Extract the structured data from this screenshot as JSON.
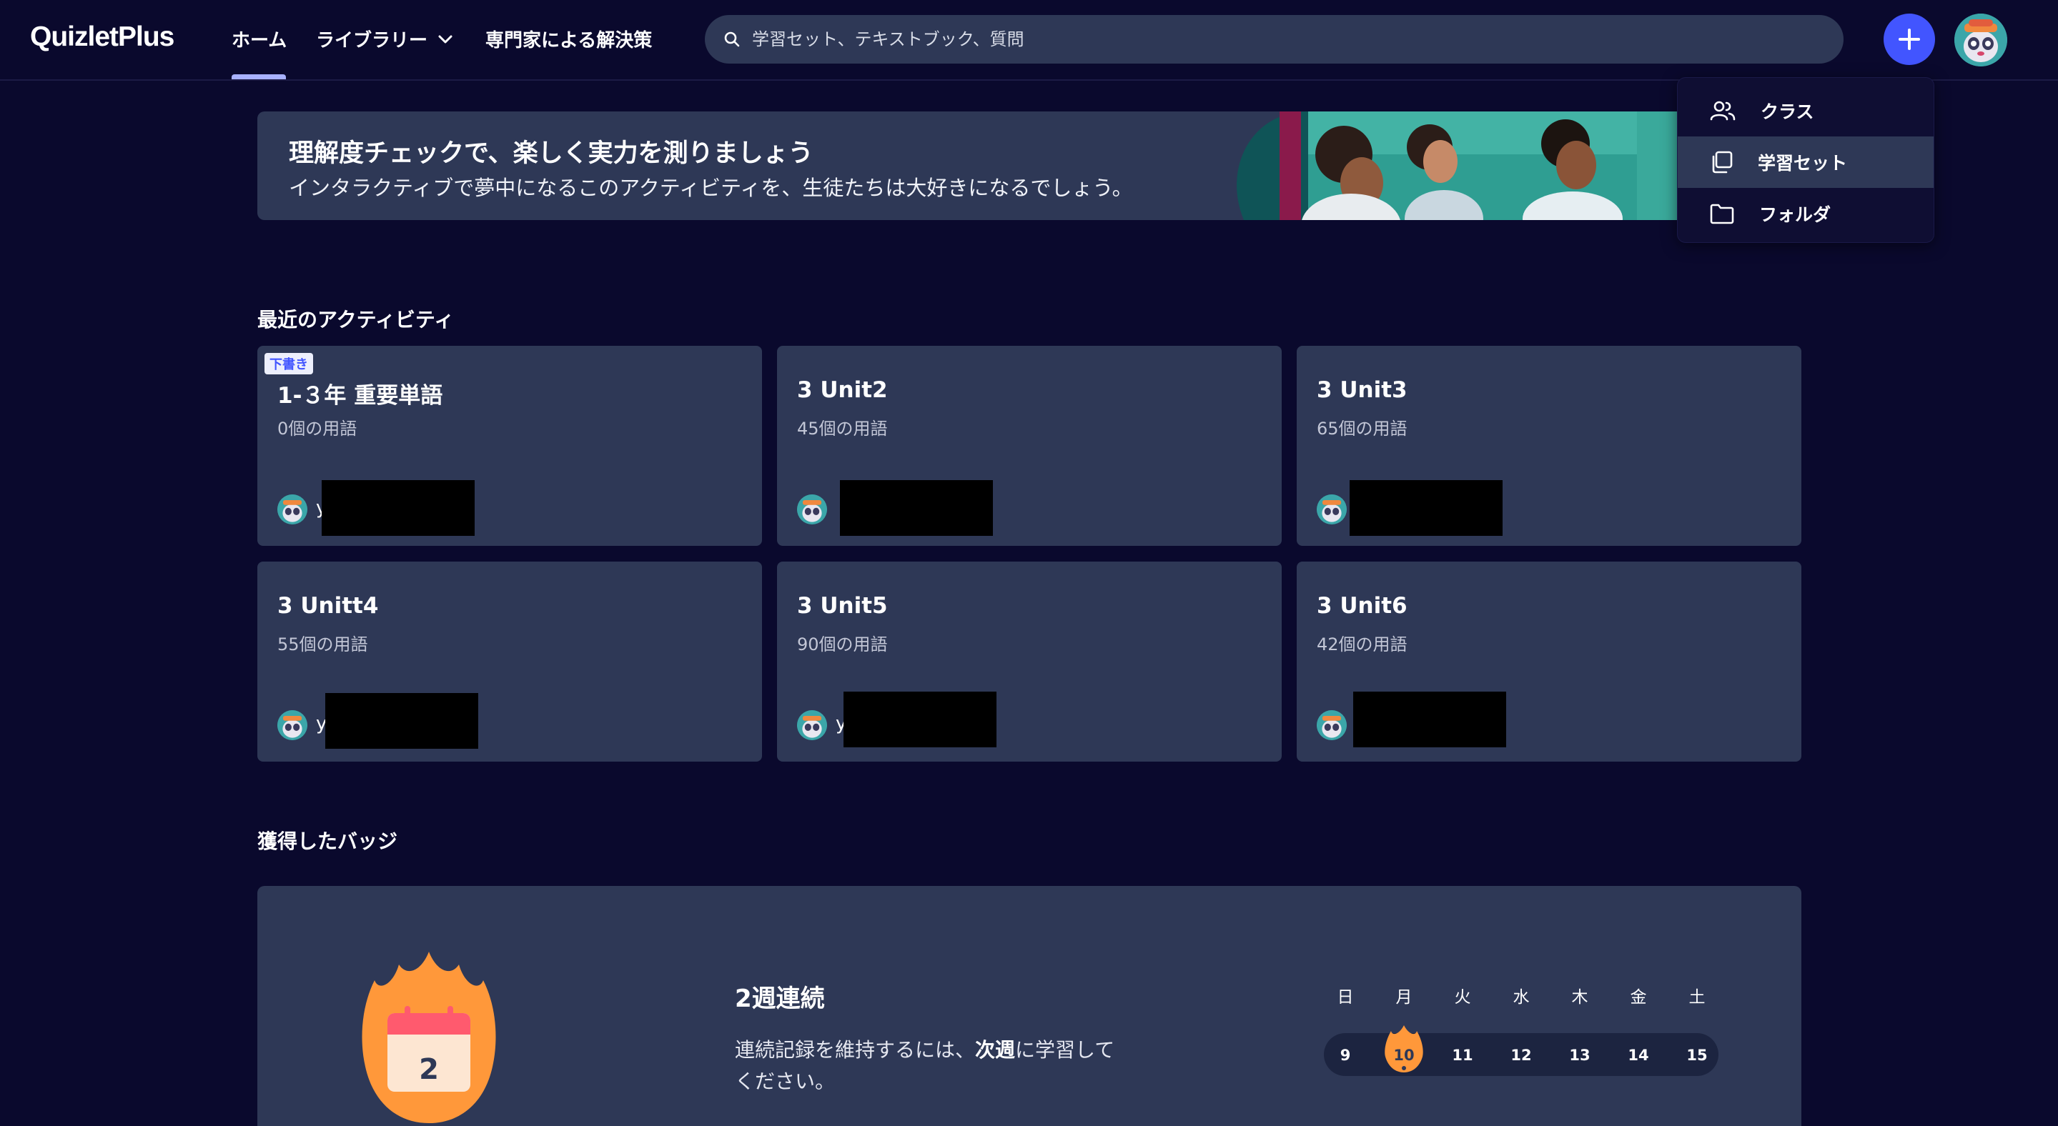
{
  "header": {
    "logo": "QuizletPlus",
    "nav": {
      "home": "ホーム",
      "library": "ライブラリー",
      "experts": "専門家による解決策"
    },
    "search_placeholder": "学習セット、テキストブック、質問"
  },
  "create_menu": {
    "items": [
      {
        "label": "クラス",
        "icon": "people-icon"
      },
      {
        "label": "学習セット",
        "icon": "cards-icon",
        "active": true
      },
      {
        "label": "フォルダ",
        "icon": "folder-icon"
      }
    ]
  },
  "banner": {
    "title": "理解度チェックで、楽しく実力を測りましょう",
    "subtitle": "インタラクティブで夢中になるこのアクティビティを、生徒たちは大好きになるでしょう。"
  },
  "recent": {
    "title": "最近のアクティビティ",
    "cards": [
      {
        "title": "1-３年 重要単語",
        "count": "0個の用語",
        "badge": "下書き",
        "user": "y"
      },
      {
        "title": "3 Unit2",
        "count": "45個の用語",
        "user": ""
      },
      {
        "title": "3 Unit3",
        "count": "65個の用語",
        "user": ""
      },
      {
        "title": "3 Unitt4",
        "count": "55個の用語",
        "user": "y"
      },
      {
        "title": "3 Unit5",
        "count": "90個の用語",
        "user": "y"
      },
      {
        "title": "3 Unit6",
        "count": "42個の用語",
        "user": ""
      }
    ]
  },
  "badges": {
    "title": "獲得したバッジ",
    "calendar_number": "2",
    "streak_title": "2週連続",
    "streak_desc_pre": "連続記録を維持するには、",
    "streak_desc_bold": "次週",
    "streak_desc_post": "に学習してください。",
    "weekdays": [
      "日",
      "月",
      "火",
      "水",
      "木",
      "金",
      "土"
    ],
    "days": [
      "9",
      "10",
      "11",
      "12",
      "13",
      "14",
      "15"
    ],
    "highlight_index": 1
  },
  "colors": {
    "background": "#0a092d",
    "card": "#2e3856",
    "accent": "#4255ff",
    "flame": "#ff983a"
  }
}
